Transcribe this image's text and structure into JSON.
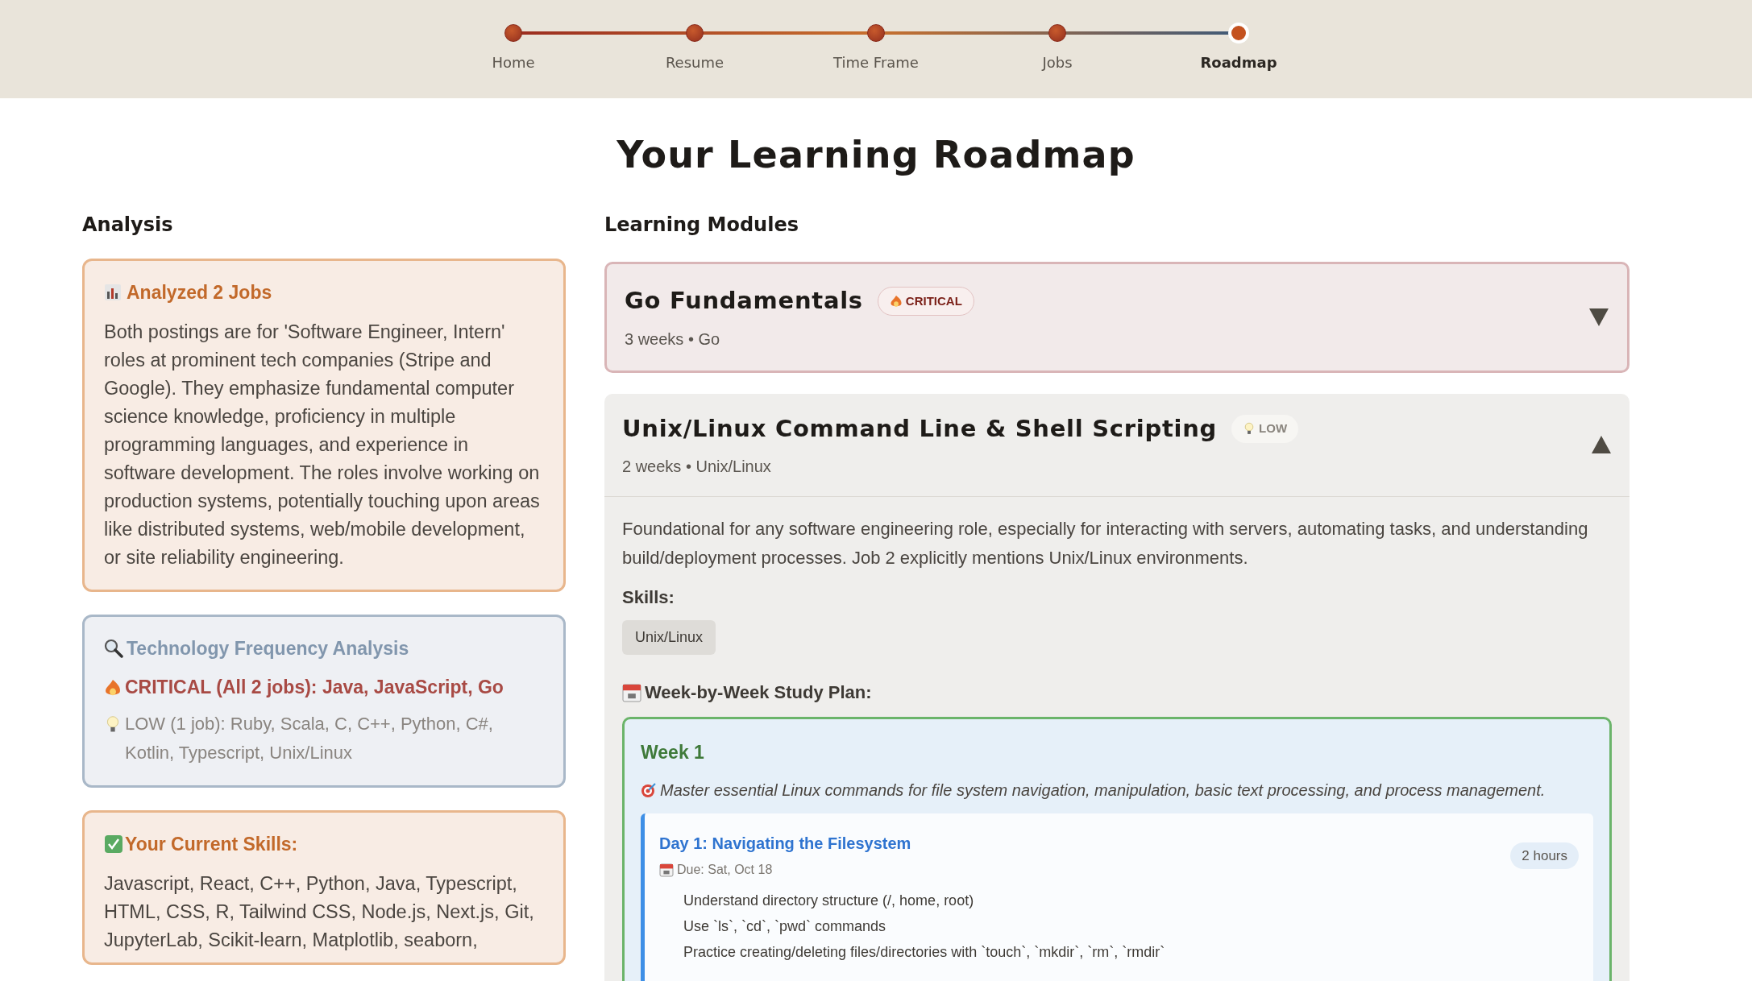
{
  "stepper": [
    {
      "label": "Home",
      "selected": false
    },
    {
      "label": "Resume",
      "selected": false
    },
    {
      "label": "Time Frame",
      "selected": false
    },
    {
      "label": "Jobs",
      "selected": false
    },
    {
      "label": "Roadmap",
      "selected": true
    }
  ],
  "page_title": "Your Learning Roadmap",
  "analysis": {
    "heading": "Analysis",
    "summary": {
      "title": "Analyzed 2 Jobs",
      "text": "Both postings are for 'Software Engineer, Intern' roles at prominent tech companies (Stripe and Google). They emphasize fundamental computer science knowledge, proficiency in multiple programming languages, and experience in software development. The roles involve working on production systems, potentially touching upon areas like distributed systems, web/mobile development, or site reliability engineering."
    },
    "frequency": {
      "title": "Technology Frequency Analysis",
      "rows": [
        {
          "kind": "critical",
          "text": "CRITICAL (All 2 jobs): Java, JavaScript, Go"
        },
        {
          "kind": "low",
          "text": "LOW (1 job): Ruby, Scala, C, C++, Python, C#, Kotlin, Typescript, Unix/Linux"
        }
      ]
    },
    "current_skills": {
      "title": "Your Current Skills:",
      "text": "Javascript, React, C++, Python, Java, Typescript, HTML, CSS, R, Tailwind CSS, Node.js, Next.js, Git, JupyterLab, Scikit-learn, Matplotlib, seaborn,"
    }
  },
  "modules": {
    "heading": "Learning Modules",
    "items": [
      {
        "title": "Go Fundamentals",
        "kind": "critical",
        "badge": "CRITICAL",
        "meta": "3 weeks • Go",
        "expanded": false
      },
      {
        "title": "Unix/Linux Command Line & Shell Scripting",
        "kind": "low",
        "badge": "LOW",
        "meta": "2 weeks • Unix/Linux",
        "expanded": true,
        "description": "Foundational for any software engineering role, especially for interacting with servers, automating tasks, and understanding build/deployment processes. Job 2 explicitly mentions Unix/Linux environments.",
        "skills_label": "Skills:",
        "skills": [
          "Unix/Linux"
        ],
        "plan_label": "Week-by-Week Study Plan:",
        "weeks": [
          {
            "title": "Week 1",
            "goal": "Master essential Linux commands for file system navigation, manipulation, basic text processing, and process management.",
            "days": [
              {
                "title": "Day 1: Navigating the Filesystem",
                "due": "Due: Sat, Oct 18",
                "duration": "2 hours",
                "tasks": [
                  "Understand directory structure (/, home, root)",
                  "Use `ls`, `cd`, `pwd` commands",
                  "Practice creating/deleting files/directories with `touch`, `mkdir`, `rm`, `rmdir`"
                ]
              }
            ]
          }
        ]
      }
    ]
  }
}
